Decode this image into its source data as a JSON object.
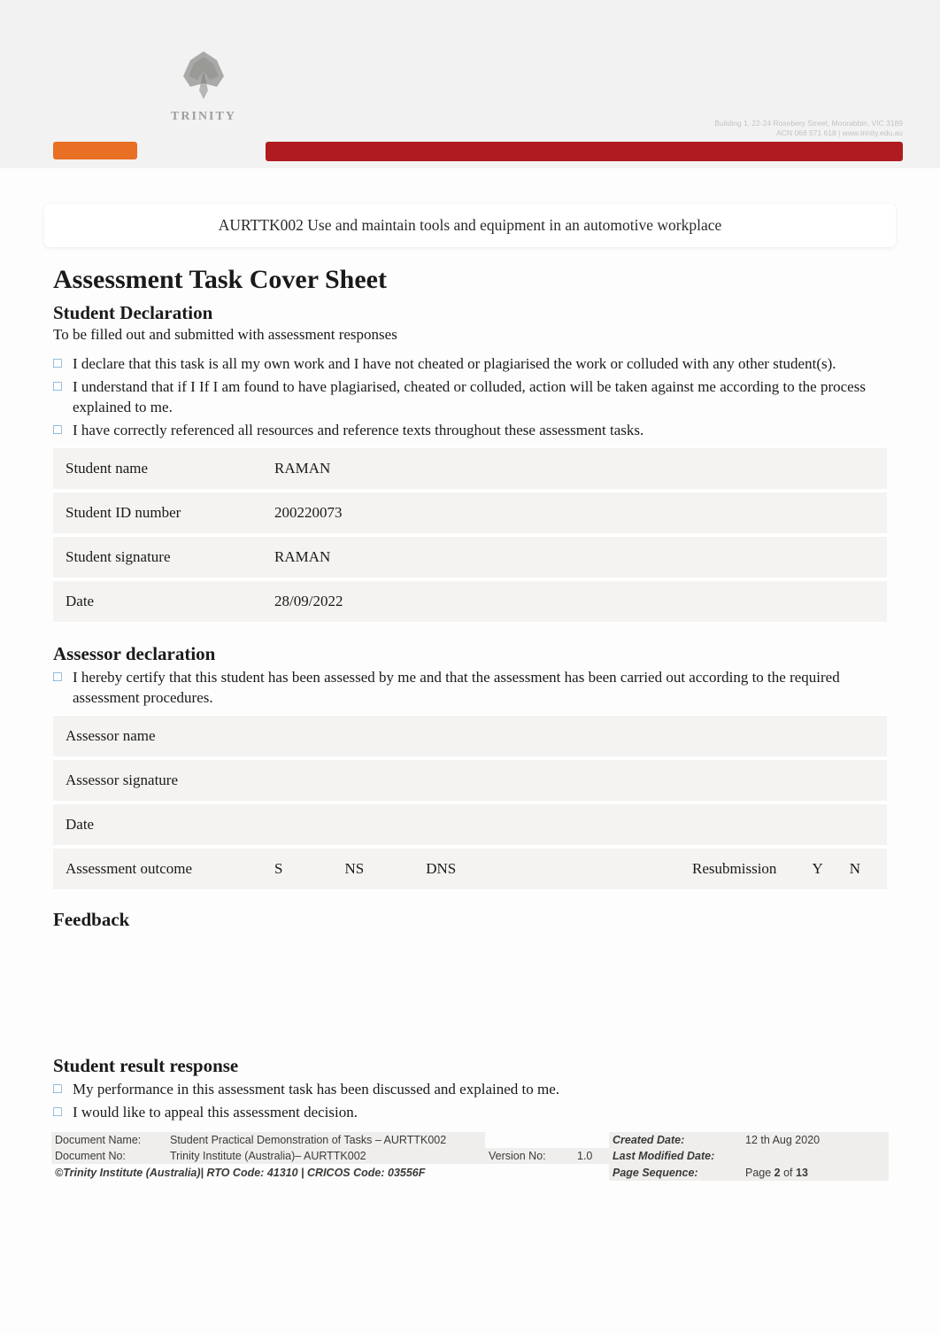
{
  "banner": {
    "logo_text": "TRINITY",
    "faint_line1": "Building 1, 22-24 Rosebery Street, Moorabbin, VIC 3189",
    "faint_line2": "ACN 068 571 618 | www.trinity.edu.au"
  },
  "unit_title": "AURTTK002 Use and maintain tools and equipment in an automotive workplace",
  "page_heading": "Assessment Task Cover Sheet",
  "student_decl": {
    "heading": "Student Declaration",
    "sub": "To be filled out and submitted with assessment responses",
    "items": [
      "I declare that this task is all my own work and I have not cheated or plagiarised the work or colluded with any other student(s).",
      "I understand that if I If I am found to have plagiarised, cheated or colluded, action will be taken against me according to the process explained to me.",
      "I have correctly referenced all resources and reference texts throughout these assessment tasks."
    ],
    "fields": {
      "student_name_label": "Student name",
      "student_name": "RAMAN",
      "student_id_label": "Student ID number",
      "student_id": "200220073",
      "signature_label": "Student signature",
      "signature": "RAMAN",
      "date_label": "Date",
      "date": "28/09/2022"
    }
  },
  "assessor_decl": {
    "heading": "Assessor declaration",
    "text": "I hereby certify that this student has been assessed by me and that the assessment has been carried out according to the required assessment procedures.",
    "fields": {
      "name_label": "Assessor name",
      "signature_label": "Assessor signature",
      "date_label": "Date",
      "outcome_label": "Assessment outcome",
      "oc_s": "S",
      "oc_ns": "NS",
      "oc_dns": "DNS",
      "resub_label": "Resubmission",
      "y": "Y",
      "n": "N"
    }
  },
  "feedback_heading": "Feedback",
  "student_result": {
    "heading": "Student result response",
    "items": [
      "My performance in this assessment task has been discussed and explained to me.",
      "I would like to appeal this assessment decision."
    ]
  },
  "footer": {
    "doc_name_label": "Document Name:",
    "doc_name": "Student Practical Demonstration of Tasks – AURTTK002",
    "doc_no_label": "Document No:",
    "doc_no": "Trinity Institute (Australia)– AURTTK002",
    "version_label": "Version No:",
    "version": "1.0",
    "created_label": "Created Date:",
    "created": "12 th Aug 2020",
    "modified_label": "Last Modified Date:",
    "copyright": "©Trinity Institute (Australia)| RTO Code: 41310 | CRICOS Code: 03556F",
    "pageseq_label": "Page Sequence:",
    "page_text_prefix": "Page ",
    "page_cur": "2",
    "page_of": " of ",
    "page_total": "13"
  }
}
